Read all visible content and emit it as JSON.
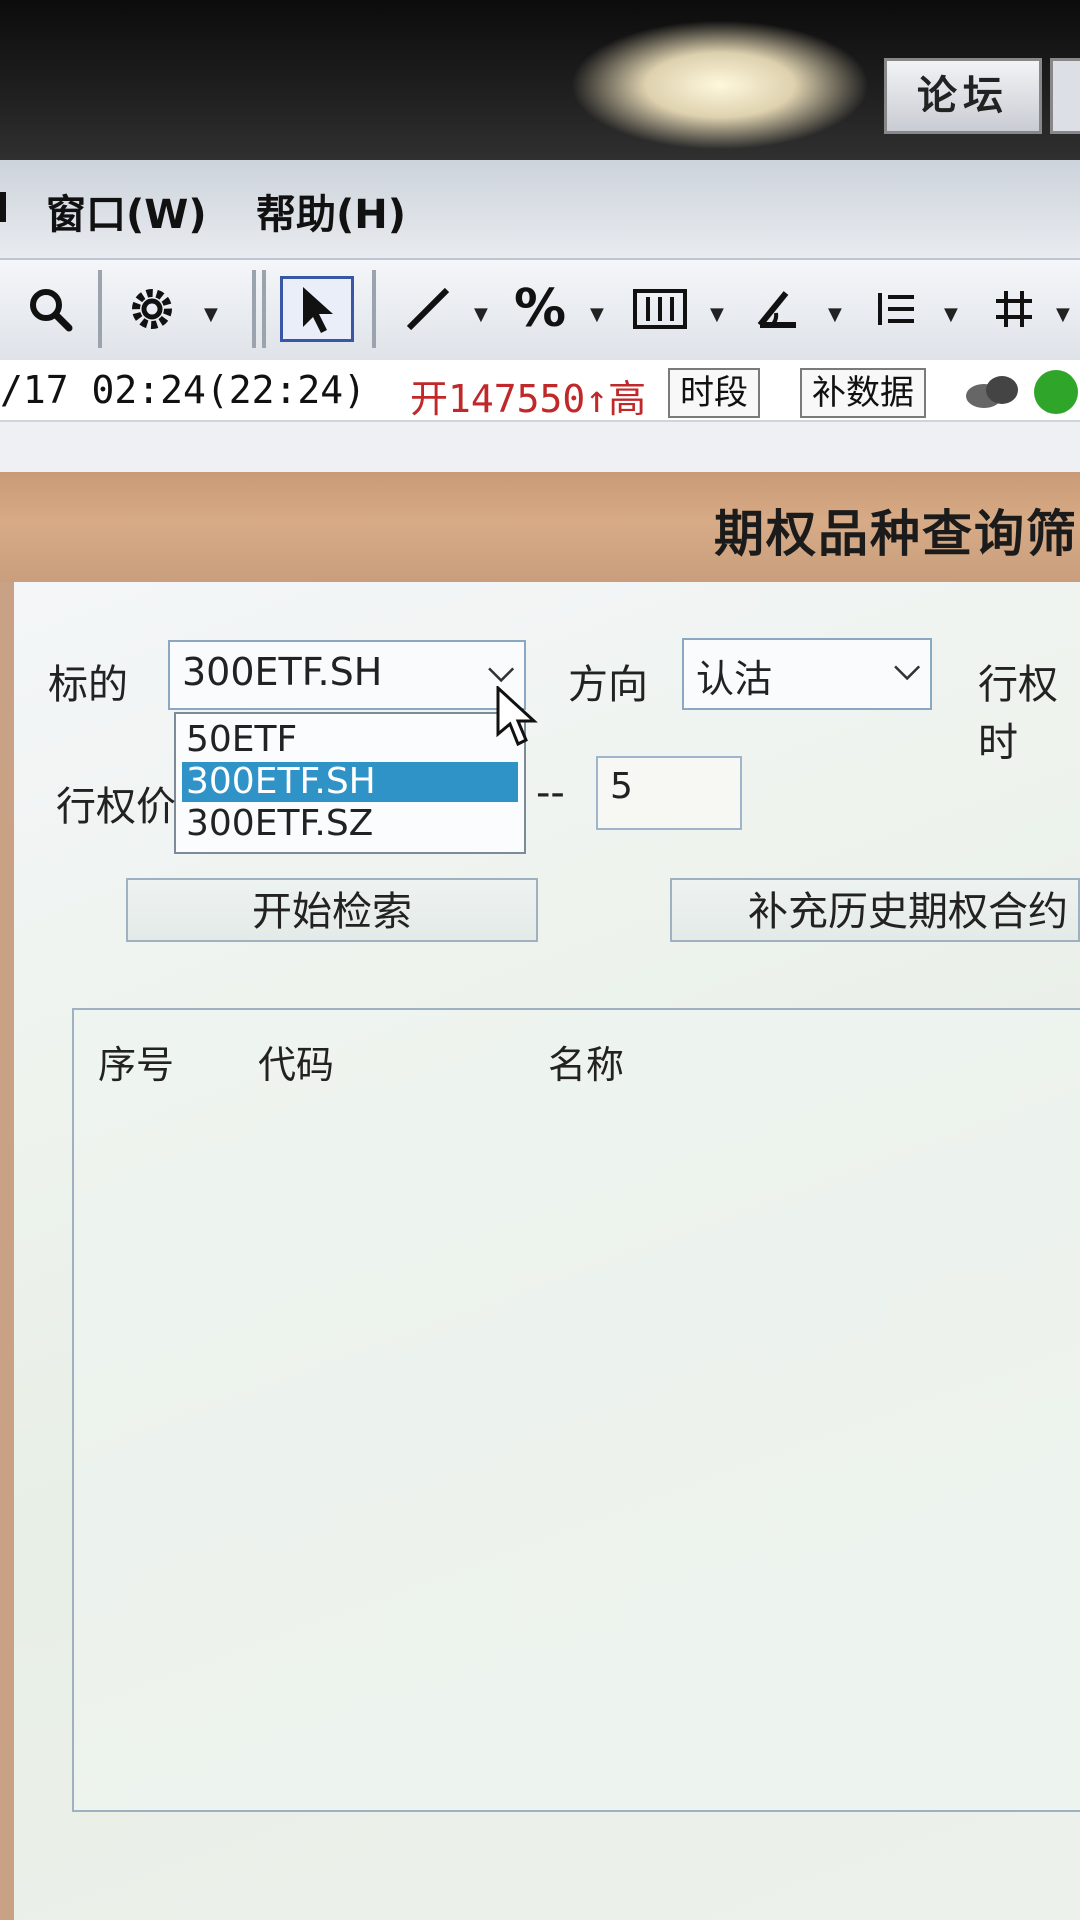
{
  "titlebar": {
    "forum_button": "论坛"
  },
  "menu": {
    "items": [
      "窗口(W)",
      "帮助(H)"
    ]
  },
  "toolbar": {
    "icons": [
      "search-icon",
      "gear-icon",
      "pointer-icon",
      "line-icon",
      "percent-icon",
      "bar-icon",
      "angle-icon",
      "list-icon",
      "grid-icon"
    ]
  },
  "status": {
    "time": "/17 02:24(22:24)",
    "open": "开147550↑高",
    "btn_period": "时段",
    "btn_fill": "补数据"
  },
  "dialog": {
    "title": "期权品种查询筛",
    "underlying_label": "标的",
    "underlying_value": "300ETF.SH",
    "underlying_options": [
      "50ETF",
      "300ETF.SH",
      "300ETF.SZ"
    ],
    "underlying_selected": "300ETF.SH",
    "direction_label": "方向",
    "direction_value": "认沽",
    "exercise_time_label": "行权时",
    "strike_label": "行权价",
    "range_sep": "--",
    "strike_max": "5",
    "search_button": "开始检索",
    "supplement_button": "补充历史期权合约"
  },
  "table": {
    "columns": [
      "序号",
      "代码",
      "名称"
    ],
    "rows": []
  }
}
